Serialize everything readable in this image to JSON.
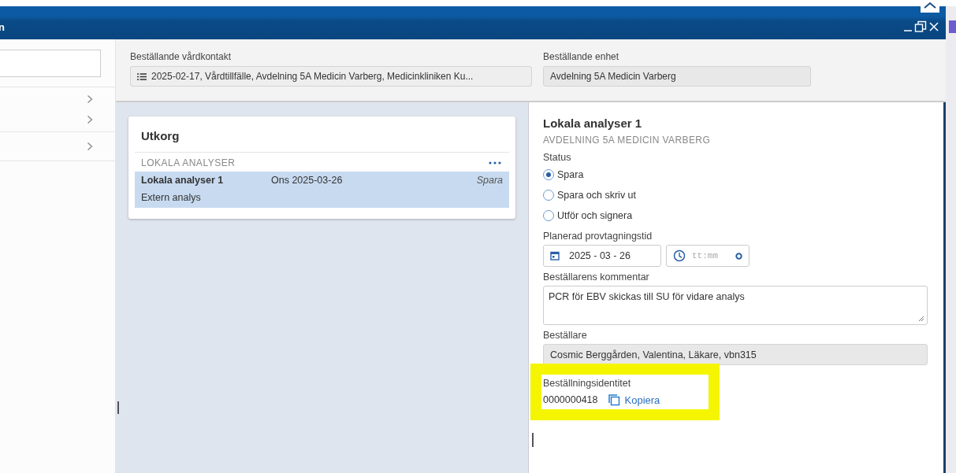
{
  "window": {
    "title": "n"
  },
  "header": {
    "contact_label": "Beställande vårdkontakt",
    "contact_value": "2025-02-17, Vårdtillfälle, Avdelning 5A Medicin Varberg, Medicinkliniken Ku...",
    "unit_label": "Beställande enhet",
    "unit_value": "Avdelning 5A Medicin Varberg"
  },
  "outbox": {
    "title": "Utkorg",
    "group": "LOKALA ANALYSER",
    "rows": [
      {
        "name": "Lokala analyser 1",
        "date": "Ons 2025-03-26",
        "status": "Spara",
        "detail": "Extern analys",
        "selected": true
      }
    ]
  },
  "detail": {
    "title": "Lokala analyser 1",
    "subtitle": "AVDELNING 5A MEDICIN VARBERG",
    "status_label": "Status",
    "status_options": [
      {
        "label": "Spara",
        "selected": true
      },
      {
        "label": "Spara och skriv ut",
        "selected": false
      },
      {
        "label": "Utför och signera",
        "selected": false
      }
    ],
    "time_label": "Planerad provtagningstid",
    "date_value": "2025 - 03 - 26",
    "time_placeholder": "tt:mm",
    "comment_label": "Beställarens kommentar",
    "comment_value": "PCR för EBV skickas till SU för vidare analys",
    "orderer_label": "Beställare",
    "orderer_value": "Cosmic Berggården, Valentina, Läkare, vbn315",
    "identity_label": "Beställningsidentitet",
    "identity_value": "0000000418",
    "copy_link": "Kopiera",
    "highlighted": true
  }
}
